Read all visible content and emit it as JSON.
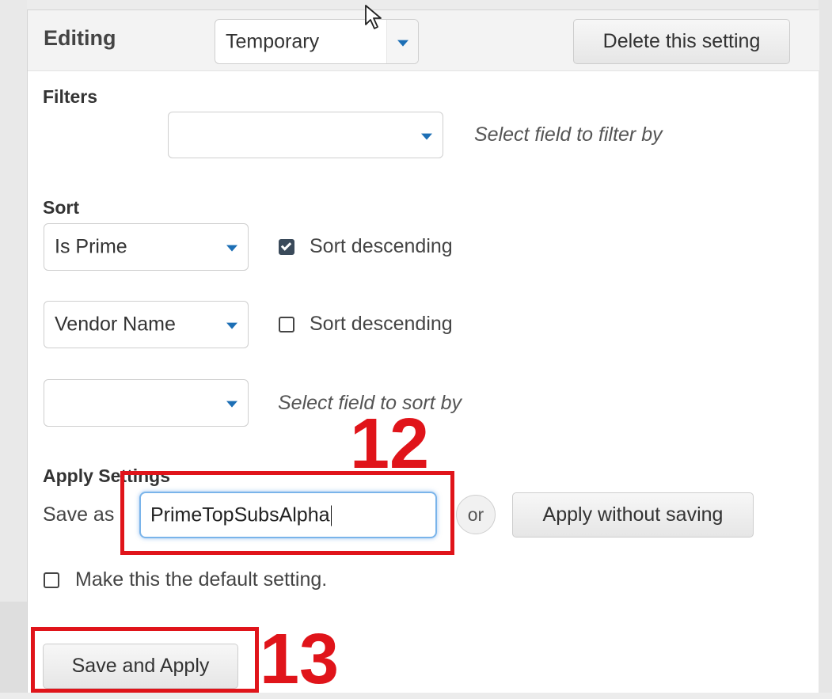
{
  "header": {
    "editing_label": "Editing",
    "setting_dropdown_value": "Temporary",
    "delete_button_label": "Delete this setting"
  },
  "filters": {
    "section_label": "Filters",
    "field_value": "",
    "hint": "Select field to filter by"
  },
  "sort": {
    "section_label": "Sort",
    "rows": [
      {
        "field": "Is Prime",
        "descending_label": "Sort descending",
        "descending_checked": true
      },
      {
        "field": "Vendor Name",
        "descending_label": "Sort descending",
        "descending_checked": false
      },
      {
        "field": "",
        "hint": "Select field to sort by"
      }
    ]
  },
  "apply_settings": {
    "section_label": "Apply Settings",
    "save_as_label": "Save as",
    "save_as_value": "PrimeTopSubsAlpha",
    "or_label": "or",
    "apply_without_saving_label": "Apply without saving",
    "default_checkbox_label": "Make this the default setting.",
    "default_checked": false,
    "save_and_apply_label": "Save and Apply"
  },
  "annotations": {
    "step_12": "12",
    "step_13": "13",
    "color": "#e0141a"
  },
  "colors": {
    "accent_caret": "#1d6fb5",
    "focus_ring": "#7ab4ea"
  }
}
